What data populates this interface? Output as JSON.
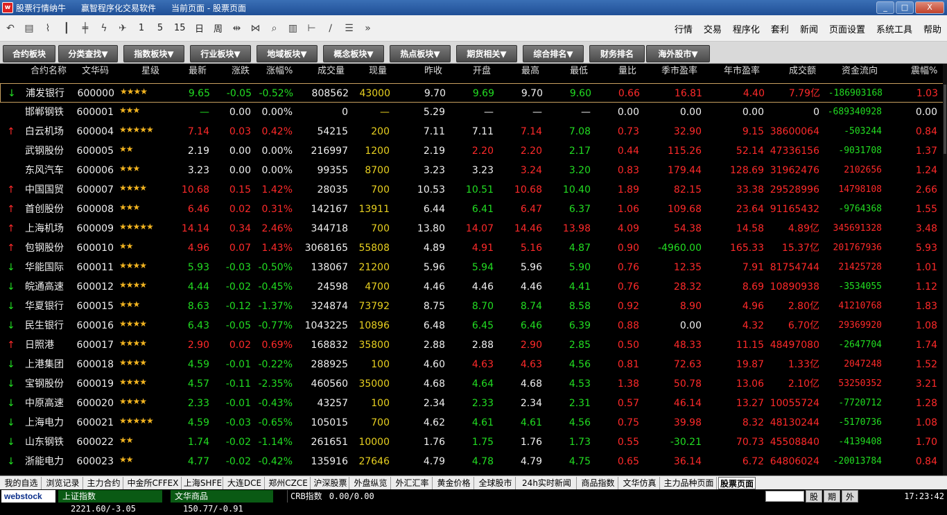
{
  "window": {
    "app_name": "股票行情纳牛",
    "software": "赢智程序化交易软件",
    "current_page_label": "当前页面 - 股票页面",
    "controls": [
      "_",
      "□",
      "X"
    ]
  },
  "toolbar": {
    "icons": [
      "undo-icon",
      "table-icon",
      "line-chart-icon",
      "kline-icon",
      "candlestick-icon",
      "lightning-icon",
      "plane-icon"
    ],
    "periods": [
      "1",
      "5",
      "15",
      "日",
      "周"
    ],
    "icons2": [
      "arrows-left-right-icon",
      "arrows-collapse-icon",
      "search-icon",
      "ruler-vertical-icon",
      "span-icon",
      "draw-line-icon",
      "list-icon",
      "more-icon"
    ],
    "menu": [
      "行情",
      "交易",
      "程序化",
      "套利",
      "新闻",
      "页面设置",
      "系统工具",
      "帮助"
    ]
  },
  "categories": [
    "合约板块",
    "分类查找▼",
    "指数板块▼",
    "行业板块▼",
    "地域板块▼",
    "概念板块▼",
    "热点板块▼",
    "期货相关▼",
    "综合排名▼",
    "财务排名",
    "海外股市▼"
  ],
  "table": {
    "headers": [
      "合约名称",
      "文华码",
      "星级",
      "最新",
      "涨跌",
      "涨幅%",
      "成交量",
      "现量",
      "昨收",
      "开盘",
      "最高",
      "最低",
      "量比",
      "季市盈率",
      "年市盈率",
      "成交额",
      "资金流向",
      "震幅%"
    ],
    "rows": [
      {
        "arrow": "↓",
        "dir": "down",
        "name": "浦发银行",
        "code": "600000",
        "stars": "★★★★",
        "last": "9.65",
        "chg": "-0.05",
        "pct": "-0.52%",
        "vol": "808562",
        "cur": "43000",
        "prev": "9.70",
        "open": "9.69",
        "high": "9.70",
        "low": "9.60",
        "vr": "0.66",
        "pe_q": "16.81",
        "pe_y": "4.40",
        "amt": "7.79亿",
        "flow": "-186903168",
        "amp": "1.03",
        "c": {
          "last": "g",
          "chg": "g",
          "pct": "g",
          "open": "g",
          "high": "w",
          "low": "g",
          "amt": "r",
          "flow": "g"
        }
      },
      {
        "arrow": "",
        "dir": "none",
        "name": "邯郸钢铁",
        "code": "600001",
        "stars": "★★★",
        "last": "—",
        "chg": "0.00",
        "pct": "0.00%",
        "vol": "0",
        "cur": "—",
        "prev": "5.29",
        "open": "—",
        "high": "—",
        "low": "—",
        "vr": "0.00",
        "pe_q": "0.00",
        "pe_y": "0.00",
        "amt": "0",
        "flow": "-689340928",
        "amp": "0.00",
        "c": {
          "last": "g",
          "chg": "w",
          "pct": "w",
          "open": "w",
          "high": "w",
          "low": "w",
          "amt": "w",
          "flow": "g"
        }
      },
      {
        "arrow": "↑",
        "dir": "up",
        "name": "白云机场",
        "code": "600004",
        "stars": "★★★★★",
        "last": "7.14",
        "chg": "0.03",
        "pct": "0.42%",
        "vol": "54215",
        "cur": "200",
        "prev": "7.11",
        "open": "7.11",
        "high": "7.14",
        "low": "7.08",
        "vr": "0.73",
        "pe_q": "32.90",
        "pe_y": "9.15",
        "amt": "38600064",
        "flow": "-503244",
        "amp": "0.84",
        "c": {
          "last": "r",
          "chg": "r",
          "pct": "r",
          "open": "w",
          "high": "r",
          "low": "g",
          "amt": "r",
          "flow": "g"
        }
      },
      {
        "arrow": "",
        "dir": "none",
        "name": "武钢股份",
        "code": "600005",
        "stars": "★★",
        "last": "2.19",
        "chg": "0.00",
        "pct": "0.00%",
        "vol": "216997",
        "cur": "1200",
        "prev": "2.19",
        "open": "2.20",
        "high": "2.20",
        "low": "2.17",
        "vr": "0.44",
        "pe_q": "115.26",
        "pe_y": "52.14",
        "amt": "47336156",
        "flow": "-9031708",
        "amp": "1.37",
        "c": {
          "last": "w",
          "chg": "w",
          "pct": "w",
          "open": "r",
          "high": "r",
          "low": "g",
          "amt": "r",
          "flow": "g"
        }
      },
      {
        "arrow": "",
        "dir": "none",
        "name": "东风汽车",
        "code": "600006",
        "stars": "★★★",
        "last": "3.23",
        "chg": "0.00",
        "pct": "0.00%",
        "vol": "99355",
        "cur": "8700",
        "prev": "3.23",
        "open": "3.23",
        "high": "3.24",
        "low": "3.20",
        "vr": "0.83",
        "pe_q": "179.44",
        "pe_y": "128.69",
        "amt": "31962476",
        "flow": "2102656",
        "amp": "1.24",
        "c": {
          "last": "w",
          "chg": "w",
          "pct": "w",
          "open": "w",
          "high": "r",
          "low": "g",
          "amt": "r",
          "flow": "r"
        }
      },
      {
        "arrow": "↑",
        "dir": "up",
        "name": "中国国贸",
        "code": "600007",
        "stars": "★★★★",
        "last": "10.68",
        "chg": "0.15",
        "pct": "1.42%",
        "vol": "28035",
        "cur": "700",
        "prev": "10.53",
        "open": "10.51",
        "high": "10.68",
        "low": "10.40",
        "vr": "1.89",
        "pe_q": "82.15",
        "pe_y": "33.38",
        "amt": "29528996",
        "flow": "14798108",
        "amp": "2.66",
        "c": {
          "last": "r",
          "chg": "r",
          "pct": "r",
          "open": "g",
          "high": "r",
          "low": "g",
          "amt": "r",
          "flow": "r"
        }
      },
      {
        "arrow": "↑",
        "dir": "up",
        "name": "首创股份",
        "code": "600008",
        "stars": "★★★",
        "last": "6.46",
        "chg": "0.02",
        "pct": "0.31%",
        "vol": "142167",
        "cur": "13911",
        "prev": "6.44",
        "open": "6.41",
        "high": "6.47",
        "low": "6.37",
        "vr": "1.06",
        "pe_q": "109.68",
        "pe_y": "23.64",
        "amt": "91165432",
        "flow": "-9764368",
        "amp": "1.55",
        "c": {
          "last": "r",
          "chg": "r",
          "pct": "r",
          "open": "g",
          "high": "r",
          "low": "g",
          "amt": "r",
          "flow": "g"
        }
      },
      {
        "arrow": "↑",
        "dir": "up",
        "name": "上海机场",
        "code": "600009",
        "stars": "★★★★★",
        "last": "14.14",
        "chg": "0.34",
        "pct": "2.46%",
        "vol": "344718",
        "cur": "700",
        "prev": "13.80",
        "open": "14.07",
        "high": "14.46",
        "low": "13.98",
        "vr": "4.09",
        "pe_q": "54.38",
        "pe_y": "14.58",
        "amt": "4.89亿",
        "flow": "345691328",
        "amp": "3.48",
        "c": {
          "last": "r",
          "chg": "r",
          "pct": "r",
          "open": "r",
          "high": "r",
          "low": "r",
          "amt": "r",
          "flow": "r"
        }
      },
      {
        "arrow": "↑",
        "dir": "up",
        "name": "包钢股份",
        "code": "600010",
        "stars": "★★",
        "last": "4.96",
        "chg": "0.07",
        "pct": "1.43%",
        "vol": "3068165",
        "cur": "55808",
        "prev": "4.89",
        "open": "4.91",
        "high": "5.16",
        "low": "4.87",
        "vr": "0.90",
        "pe_q": "-4960.00",
        "pe_y": "165.33",
        "amt": "15.37亿",
        "flow": "201767936",
        "amp": "5.93",
        "c": {
          "last": "r",
          "chg": "r",
          "pct": "r",
          "open": "r",
          "high": "r",
          "low": "g",
          "amt": "r",
          "flow": "r",
          "pe_q": "g"
        }
      },
      {
        "arrow": "↓",
        "dir": "down",
        "name": "华能国际",
        "code": "600011",
        "stars": "★★★★",
        "last": "5.93",
        "chg": "-0.03",
        "pct": "-0.50%",
        "vol": "138067",
        "cur": "21200",
        "prev": "5.96",
        "open": "5.94",
        "high": "5.96",
        "low": "5.90",
        "vr": "0.76",
        "pe_q": "12.35",
        "pe_y": "7.91",
        "amt": "81754744",
        "flow": "21425728",
        "amp": "1.01",
        "c": {
          "last": "g",
          "chg": "g",
          "pct": "g",
          "open": "g",
          "high": "w",
          "low": "g",
          "amt": "r",
          "flow": "r"
        }
      },
      {
        "arrow": "↓",
        "dir": "down",
        "name": "皖通高速",
        "code": "600012",
        "stars": "★★★★",
        "last": "4.44",
        "chg": "-0.02",
        "pct": "-0.45%",
        "vol": "24598",
        "cur": "4700",
        "prev": "4.46",
        "open": "4.46",
        "high": "4.46",
        "low": "4.41",
        "vr": "0.76",
        "pe_q": "28.32",
        "pe_y": "8.69",
        "amt": "10890938",
        "flow": "-3534055",
        "amp": "1.12",
        "c": {
          "last": "g",
          "chg": "g",
          "pct": "g",
          "open": "w",
          "high": "w",
          "low": "g",
          "amt": "r",
          "flow": "g"
        }
      },
      {
        "arrow": "↓",
        "dir": "down",
        "name": "华夏银行",
        "code": "600015",
        "stars": "★★★",
        "last": "8.63",
        "chg": "-0.12",
        "pct": "-1.37%",
        "vol": "324874",
        "cur": "73792",
        "prev": "8.75",
        "open": "8.70",
        "high": "8.74",
        "low": "8.58",
        "vr": "0.92",
        "pe_q": "8.90",
        "pe_y": "4.96",
        "amt": "2.80亿",
        "flow": "41210768",
        "amp": "1.83",
        "c": {
          "last": "g",
          "chg": "g",
          "pct": "g",
          "open": "g",
          "high": "g",
          "low": "g",
          "amt": "r",
          "flow": "r"
        }
      },
      {
        "arrow": "↓",
        "dir": "down",
        "name": "民生银行",
        "code": "600016",
        "stars": "★★★★",
        "last": "6.43",
        "chg": "-0.05",
        "pct": "-0.77%",
        "vol": "1043225",
        "cur": "10896",
        "prev": "6.48",
        "open": "6.45",
        "high": "6.46",
        "low": "6.39",
        "vr": "0.88",
        "pe_q": "0.00",
        "pe_y": "4.32",
        "amt": "6.70亿",
        "flow": "29369920",
        "amp": "1.08",
        "c": {
          "last": "g",
          "chg": "g",
          "pct": "g",
          "open": "g",
          "high": "g",
          "low": "g",
          "amt": "r",
          "flow": "r",
          "pe_q": "w"
        }
      },
      {
        "arrow": "↑",
        "dir": "up",
        "name": "日照港",
        "code": "600017",
        "stars": "★★★★",
        "last": "2.90",
        "chg": "0.02",
        "pct": "0.69%",
        "vol": "168832",
        "cur": "35800",
        "prev": "2.88",
        "open": "2.88",
        "high": "2.90",
        "low": "2.85",
        "vr": "0.50",
        "pe_q": "48.33",
        "pe_y": "11.15",
        "amt": "48497080",
        "flow": "-2647704",
        "amp": "1.74",
        "c": {
          "last": "r",
          "chg": "r",
          "pct": "r",
          "open": "w",
          "high": "r",
          "low": "g",
          "amt": "r",
          "flow": "g"
        }
      },
      {
        "arrow": "↓",
        "dir": "down",
        "name": "上港集团",
        "code": "600018",
        "stars": "★★★★",
        "last": "4.59",
        "chg": "-0.01",
        "pct": "-0.22%",
        "vol": "288925",
        "cur": "100",
        "prev": "4.60",
        "open": "4.63",
        "high": "4.63",
        "low": "4.56",
        "vr": "0.81",
        "pe_q": "72.63",
        "pe_y": "19.87",
        "amt": "1.33亿",
        "flow": "2047248",
        "amp": "1.52",
        "c": {
          "last": "g",
          "chg": "g",
          "pct": "g",
          "open": "r",
          "high": "r",
          "low": "g",
          "amt": "r",
          "flow": "r"
        }
      },
      {
        "arrow": "↓",
        "dir": "down",
        "name": "宝钢股份",
        "code": "600019",
        "stars": "★★★★",
        "last": "4.57",
        "chg": "-0.11",
        "pct": "-2.35%",
        "vol": "460560",
        "cur": "35000",
        "prev": "4.68",
        "open": "4.64",
        "high": "4.68",
        "low": "4.53",
        "vr": "1.38",
        "pe_q": "50.78",
        "pe_y": "13.06",
        "amt": "2.10亿",
        "flow": "53250352",
        "amp": "3.21",
        "c": {
          "last": "g",
          "chg": "g",
          "pct": "g",
          "open": "g",
          "high": "w",
          "low": "g",
          "amt": "r",
          "flow": "r"
        }
      },
      {
        "arrow": "↓",
        "dir": "down",
        "name": "中原高速",
        "code": "600020",
        "stars": "★★★★",
        "last": "2.33",
        "chg": "-0.01",
        "pct": "-0.43%",
        "vol": "43257",
        "cur": "100",
        "prev": "2.34",
        "open": "2.33",
        "high": "2.34",
        "low": "2.31",
        "vr": "0.57",
        "pe_q": "46.14",
        "pe_y": "13.27",
        "amt": "10055724",
        "flow": "-7720712",
        "amp": "1.28",
        "c": {
          "last": "g",
          "chg": "g",
          "pct": "g",
          "open": "g",
          "high": "w",
          "low": "g",
          "amt": "r",
          "flow": "g"
        }
      },
      {
        "arrow": "↓",
        "dir": "down",
        "name": "上海电力",
        "code": "600021",
        "stars": "★★★★★",
        "last": "4.59",
        "chg": "-0.03",
        "pct": "-0.65%",
        "vol": "105015",
        "cur": "700",
        "prev": "4.62",
        "open": "4.61",
        "high": "4.61",
        "low": "4.56",
        "vr": "0.75",
        "pe_q": "39.98",
        "pe_y": "8.32",
        "amt": "48130244",
        "flow": "-5170736",
        "amp": "1.08",
        "c": {
          "last": "g",
          "chg": "g",
          "pct": "g",
          "open": "g",
          "high": "g",
          "low": "g",
          "amt": "r",
          "flow": "g"
        }
      },
      {
        "arrow": "↓",
        "dir": "down",
        "name": "山东钢铁",
        "code": "600022",
        "stars": "★★",
        "last": "1.74",
        "chg": "-0.02",
        "pct": "-1.14%",
        "vol": "261651",
        "cur": "10000",
        "prev": "1.76",
        "open": "1.75",
        "high": "1.76",
        "low": "1.73",
        "vr": "0.55",
        "pe_q": "-30.21",
        "pe_y": "70.73",
        "amt": "45508840",
        "flow": "-4139408",
        "amp": "1.70",
        "c": {
          "last": "g",
          "chg": "g",
          "pct": "g",
          "open": "g",
          "high": "w",
          "low": "g",
          "amt": "r",
          "flow": "g",
          "pe_q": "g"
        }
      },
      {
        "arrow": "↓",
        "dir": "down",
        "name": "浙能电力",
        "code": "600023",
        "stars": "★★",
        "last": "4.77",
        "chg": "-0.02",
        "pct": "-0.42%",
        "vol": "135916",
        "cur": "27646",
        "prev": "4.79",
        "open": "4.78",
        "high": "4.79",
        "low": "4.75",
        "vr": "0.65",
        "pe_q": "36.14",
        "pe_y": "6.72",
        "amt": "64806024",
        "flow": "-20013784",
        "amp": "0.84",
        "c": {
          "last": "g",
          "chg": "g",
          "pct": "g",
          "open": "g",
          "high": "w",
          "low": "g",
          "amt": "r",
          "flow": "g"
        }
      }
    ]
  },
  "bottom_tabs": [
    "我的自选",
    "浏览记录",
    "主力合约",
    "中金所CFFEX",
    "上海SHFE",
    "大连DCE",
    "郑州CZCE",
    "沪深股票",
    "外盘纵览",
    "外汇汇率",
    "黄金价格",
    "全球股市",
    "24h实时新闻",
    "商品指数",
    "文华仿真",
    "主力品种页面",
    "股票页面"
  ],
  "active_bottom_tab": "股票页面",
  "status": {
    "logo": "webstock",
    "idx1_name": "上证指数",
    "idx1_val": "2221.60/-3.05",
    "idx2_name": "文华商品",
    "idx2_val": "150.77/-0.91",
    "idx3_name": "CRB指数",
    "idx3_val": "0.00/0.00",
    "btn_stock": "股",
    "btn_period": "期",
    "btn_fx": "外",
    "time": "17:23:42"
  },
  "colors": {
    "red": "#ff2a2a",
    "green": "#22dd22",
    "white": "#f0f0f0",
    "yellow": "#e8d020",
    "gold": "#f2b420"
  }
}
